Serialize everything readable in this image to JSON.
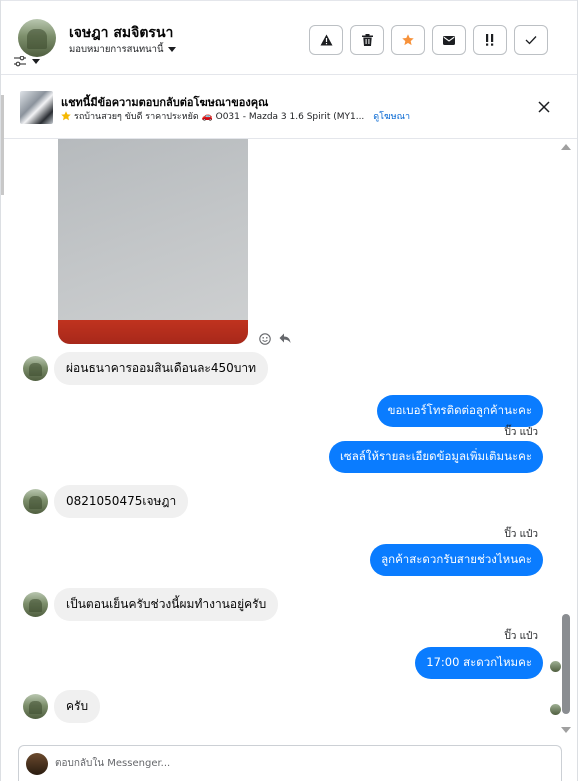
{
  "header": {
    "contact_name": "เจษฎา สมจิตรนา",
    "assign_label": "มอบหมายการสนทนานี้",
    "actions": [
      {
        "name": "report-spam-button",
        "icon": "warning-icon"
      },
      {
        "name": "delete-button",
        "icon": "trash-icon"
      },
      {
        "name": "star-button",
        "icon": "star-icon"
      },
      {
        "name": "mark-unread-button",
        "icon": "envelope-icon"
      },
      {
        "name": "follow-up-button",
        "icon": "exclamation-icon"
      },
      {
        "name": "mark-done-button",
        "icon": "check-icon"
      }
    ]
  },
  "ad": {
    "title": "แชทนี้มีข้อความตอบกลับต่อโฆษณาของคุณ",
    "subtitle": "รถบ้านสวยๆ ขับดี ราคาประหยัด 🚗 O031 - Mazda 3 1.6 Spirit (MY1...",
    "link_label": "ดูโฆษณา"
  },
  "messages": {
    "m1": "ผ่อนธนาคารออมสินเดือนละ450บาท",
    "m2": "ขอเบอร์โทรติดต่อลูกค้านะคะ",
    "m3_seen": "ปิ๊ว แป๋ว",
    "m3": "เซลล์ให้รายละเอียดข้อมูลเพิ่มเติมนะคะ",
    "m4": "0821050475เจษฎา",
    "m5_seen": "ปิ๊ว แป๋ว",
    "m5": "ลูกค้าสะดวกรับสายช่วงไหนคะ",
    "m6": "เป็นตอนเย็นครับช่วงนี้ผมทำงานอยู่ครับ",
    "m7_seen": "ปิ๊ว แป๋ว",
    "m7": "17:00 สะดวกไหมคะ",
    "m8": "ครับ"
  },
  "composer": {
    "placeholder": "ตอบกลับใน Messenger..."
  },
  "colors": {
    "outgoing_bubble": "#0a7cff",
    "incoming_bubble": "#f0f0f0",
    "link": "#0064d1",
    "star": "#f7923b"
  }
}
